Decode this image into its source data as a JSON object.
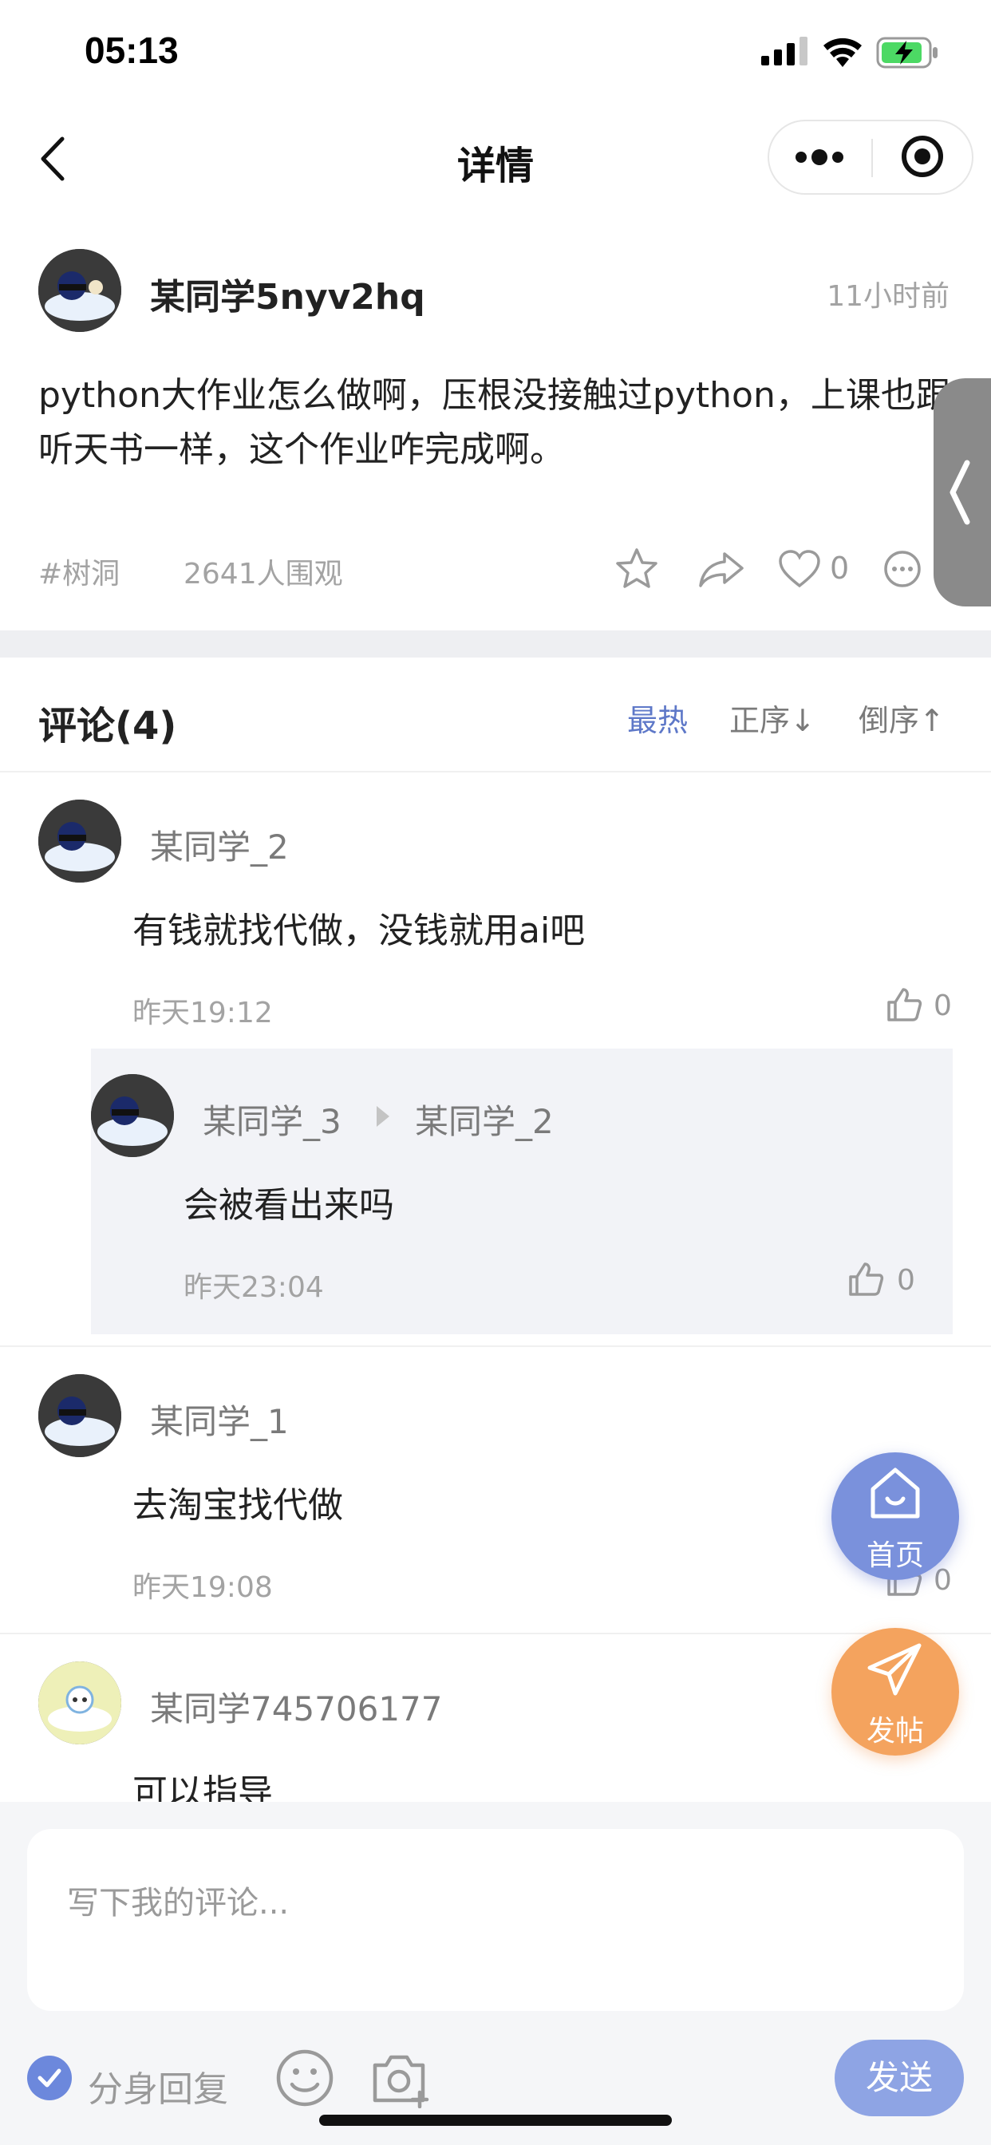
{
  "status_bar": {
    "time": "05:13"
  },
  "nav": {
    "title": "详情"
  },
  "post": {
    "author": "某同学5nyv2hq",
    "time": "11小时前",
    "body": "python大作业怎么做啊，压根没接触过python，上课也跟听天书一样，这个作业咋完成啊。",
    "tag": "#树洞",
    "views": "2641人围观",
    "likes": "0"
  },
  "comments_header": {
    "title": "评论(4)",
    "sort_hot": "最热",
    "sort_asc": "正序↓",
    "sort_desc": "倒序↑"
  },
  "comments": [
    {
      "name": "某同学_2",
      "text": "有钱就找代做，没钱就用ai吧",
      "time": "昨天19:12",
      "likes": "0",
      "reply": {
        "name": "某同学_3",
        "to": "某同学_2",
        "text": "会被看出来吗",
        "time": "昨天23:04",
        "likes": "0"
      }
    },
    {
      "name": "某同学_1",
      "text": "去淘宝找代做",
      "time": "昨天19:08",
      "likes": "0"
    },
    {
      "name": "某同学745706177",
      "text": "可以指导"
    }
  ],
  "fab": {
    "home": "首页",
    "post": "发帖"
  },
  "composer": {
    "placeholder": "写下我的评论...",
    "alias_label": "分身回复",
    "send": "发送"
  },
  "colors": {
    "accent": "#5e78c8",
    "home_fab": "#7a91dc",
    "post_fab": "#f4a35e",
    "send": "#8ea4e4"
  }
}
